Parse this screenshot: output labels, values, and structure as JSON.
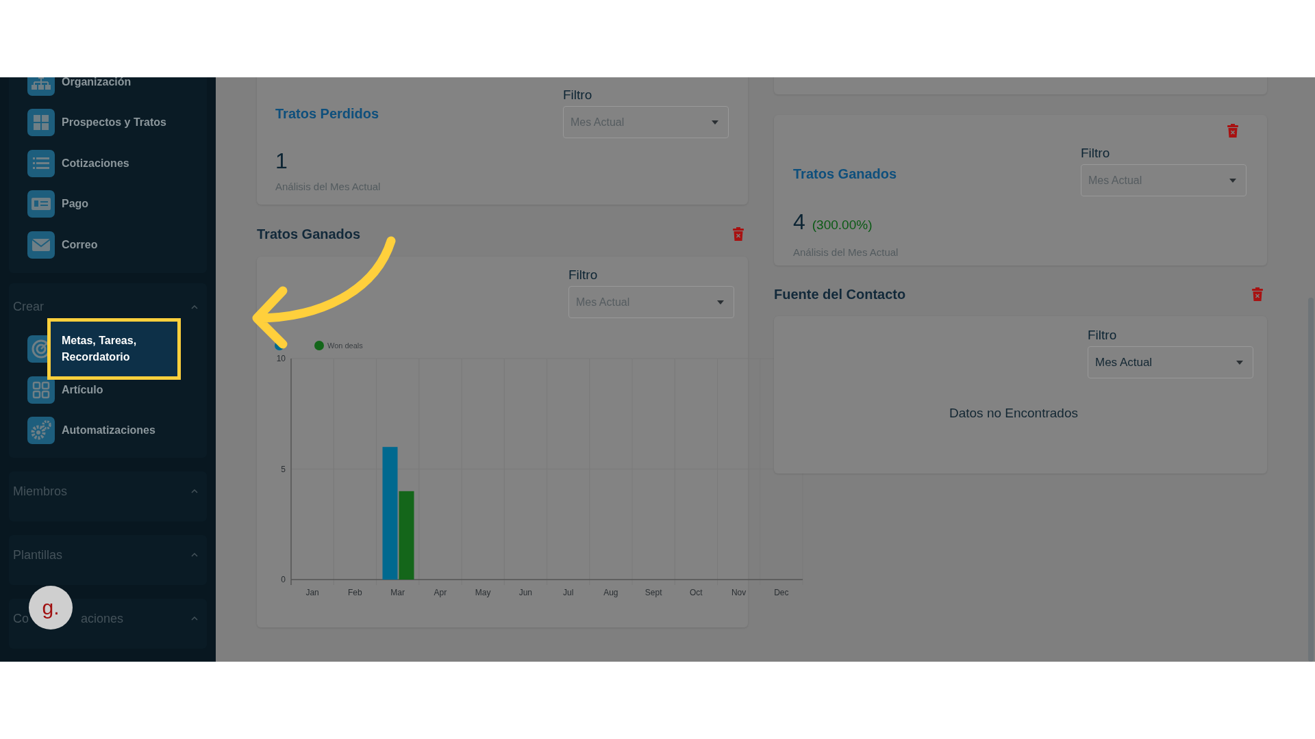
{
  "sidebar": {
    "nav_items": [
      {
        "label": "Organización",
        "kind": "org"
      },
      {
        "label": "Prospectos y Tratos",
        "kind": "tiles"
      },
      {
        "label": "Cotizaciones",
        "kind": "list"
      },
      {
        "label": "Pago",
        "kind": "payment"
      },
      {
        "label": "Correo",
        "kind": "mail"
      }
    ],
    "sections": [
      {
        "title": "Crear",
        "items": [
          {
            "label": "Metas, Tareas, Recordatorio",
            "kind": "target",
            "selected": true
          },
          {
            "label": "Artículo",
            "kind": "grid",
            "selected": false
          },
          {
            "label": "Automatizaciones",
            "kind": "gears",
            "selected": false
          }
        ]
      },
      {
        "title": "Miembros"
      },
      {
        "title": "Plantillas"
      },
      {
        "title_parts": [
          "Co",
          "aciones"
        ]
      }
    ]
  },
  "help_button": {
    "label": "g."
  },
  "lost_deals_card": {
    "title": "Tratos Perdidos",
    "filter_label": "Filtro",
    "filter": {
      "placeholder": "Mes Actual"
    },
    "count": "1",
    "caption": "Análisis del Mes Actual"
  },
  "won_deals_chart_panel": {
    "title": "Tratos Ganados",
    "filter_label": "Filtro",
    "filter": {
      "placeholder": "Mes Actual"
    },
    "chart_data": {
      "type": "bar",
      "categories": [
        "Jan",
        "Feb",
        "Mar",
        "Apr",
        "May",
        "Jun",
        "Jul",
        "Aug",
        "Sept",
        "Oct",
        "Nov",
        "Dec"
      ],
      "ylim": [
        0,
        10
      ],
      "yticks": [
        0,
        5,
        10
      ],
      "series": [
        {
          "color": "#00698f",
          "values": [
            0,
            0,
            6,
            0,
            0,
            0,
            0,
            0,
            0,
            0,
            0,
            0
          ]
        },
        {
          "name": "Won deals",
          "color": "#14661a",
          "values": [
            0,
            0,
            4,
            0,
            0,
            0,
            0,
            0,
            0,
            0,
            0,
            0
          ]
        }
      ]
    }
  },
  "won_deals_card": {
    "title": "Tratos Ganados",
    "filter_label": "Filtro",
    "filter": {
      "placeholder": "Mes Actual"
    },
    "count": "4",
    "change": "(300.00%)",
    "caption": "Análisis del Mes Actual"
  },
  "contact_source_panel": {
    "title": "Fuente del Contacto",
    "filter_label": "Filtro",
    "filter": {
      "value": "Mes Actual"
    },
    "empty_message": "Datos no Encontrados"
  }
}
